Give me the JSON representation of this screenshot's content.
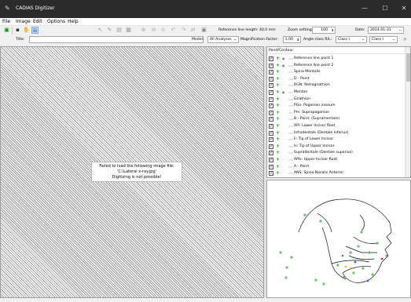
{
  "window": {
    "title": "CADIAS Digitizer"
  },
  "menu": [
    "File",
    "Image",
    "Edit",
    "Options",
    "Help"
  ],
  "toolbar": {
    "reference_label": "Reference line length: 40.0 mm",
    "zoom_label": "Zoom settings:",
    "zoom_value": "100",
    "date_label": "Date:",
    "date_value": "2014-01-31",
    "title_label": "Title:",
    "model_label": "Model:",
    "model_value": "All Analyses",
    "magnification_label": "Magnification Factor:",
    "magnification_value": "1.00",
    "angle_label": "Angle class R/L:",
    "class_r": "Class I",
    "class_l": "Class I"
  },
  "error": {
    "line1": "Failed to load the following image file:",
    "line2": "'C:\\Lateral x-ray.jpg'",
    "line3": "Digitizing is not possible!"
  },
  "tree": {
    "header": "Point/Contour",
    "items": [
      "Reference line point 1",
      "Reference line point 2",
      "Spina Mentalis",
      "D - Point",
      "RGN: Retrognathion",
      "Menton",
      "Gnathion",
      "PGo: Pogonion osseum",
      "Pm: Suprapogonion",
      "B - Point: (Supramentale)",
      "APi: Lower Incisor Root",
      "Infradentale (Dentale inferius)",
      "Ii: Tip of Lower Incisor",
      "Is: Tip of Upper Incisor",
      "Supradentale (Dentale superius)",
      "APIs: Upper Incisor Root",
      "A - Point",
      "ANS: Spina Nasalis Anterior"
    ],
    "eye_rows": [
      0,
      1,
      5
    ]
  }
}
